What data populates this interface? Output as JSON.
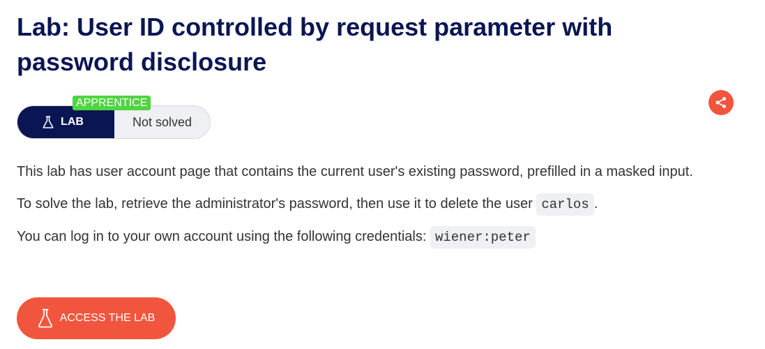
{
  "title": "Lab: User ID controlled by request parameter with password disclosure",
  "level_tag": "APPRENTICE",
  "lab_badge": {
    "type_label": "LAB",
    "status": "Not solved"
  },
  "description": {
    "p1": "This lab has user account page that contains the current user's existing password, prefilled in a masked input.",
    "p2_before": "To solve the lab, retrieve the administrator's password, then use it to delete the user ",
    "p2_code": "carlos",
    "p2_after": ".",
    "p3_before": "You can log in to your own account using the following credentials: ",
    "p3_code": "wiener:peter"
  },
  "access_button": {
    "label": "ACCESS THE LAB"
  },
  "icons": {
    "share": "share-icon",
    "flask": "flask-icon"
  },
  "colors": {
    "title": "#0a1653",
    "accent": "#f2553d",
    "level_tag": "#4fd541",
    "lab_pill": "#0a1653",
    "code_bg": "#eef0f3"
  }
}
